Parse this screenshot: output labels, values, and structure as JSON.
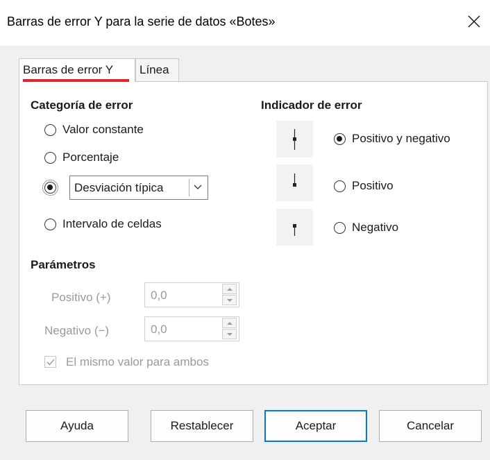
{
  "dialog": {
    "title": "Barras de error Y para la serie de datos «Botes»"
  },
  "tabs": [
    {
      "label": "Barras de error Y",
      "active": true
    },
    {
      "label": "Línea",
      "active": false
    }
  ],
  "error_category": {
    "heading": "Categoría de error",
    "options": [
      {
        "label": "Valor constante",
        "checked": false
      },
      {
        "label": "Porcentaje",
        "checked": false
      },
      {
        "label": "",
        "checked": true
      },
      {
        "label": "Intervalo de celdas",
        "checked": false
      }
    ],
    "function_select": {
      "value": "Desviación típica"
    }
  },
  "error_indicator": {
    "heading": "Indicador de error",
    "options": [
      {
        "label": "Positivo y negativo",
        "checked": true
      },
      {
        "label": "Positivo",
        "checked": false
      },
      {
        "label": "Negativo",
        "checked": false
      }
    ]
  },
  "parameters": {
    "heading": "Parámetros",
    "positive": {
      "label": "Positivo (+)",
      "value": "0,0"
    },
    "negative": {
      "label": "Negativo (−)",
      "value": "0,0"
    },
    "same_value": {
      "label": "El mismo valor para ambos",
      "checked": true
    }
  },
  "buttons": {
    "help": "Ayuda",
    "reset": "Restablecer",
    "ok": "Aceptar",
    "cancel": "Cancelar"
  },
  "colors": {
    "tab_underline": "#e3242b",
    "default_button_border": "#0078d7",
    "disabled_text": "#9a9a9a"
  }
}
